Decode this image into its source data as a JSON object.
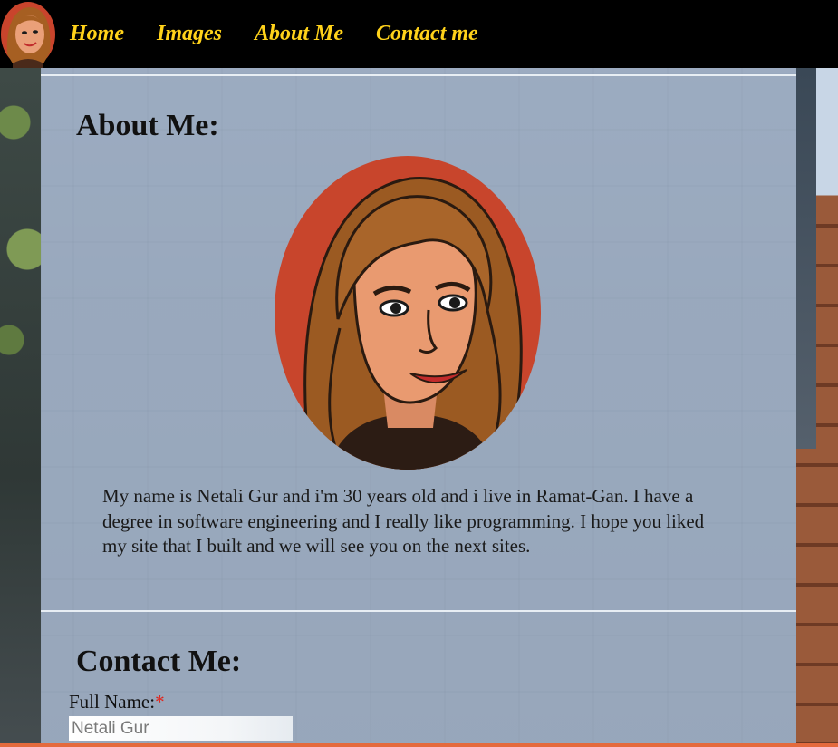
{
  "nav": {
    "items": [
      "Home",
      "Images",
      "About Me",
      "Contact me"
    ]
  },
  "about": {
    "title": "About Me:",
    "bio": "My name is Netali Gur and i'm 30 years old and i live in Ramat-Gan. I have a degree in software engineering and I really like programming. I hope you liked my site that I built and we will see you on the next sites."
  },
  "contact": {
    "title": "Contact Me:",
    "full_name_label": "Full Name:",
    "required_mark": "*",
    "full_name_value": "Netali Gur"
  },
  "colors": {
    "nav_link": "#ffd21a",
    "header_bg": "#000000",
    "required": "#e2231a"
  }
}
